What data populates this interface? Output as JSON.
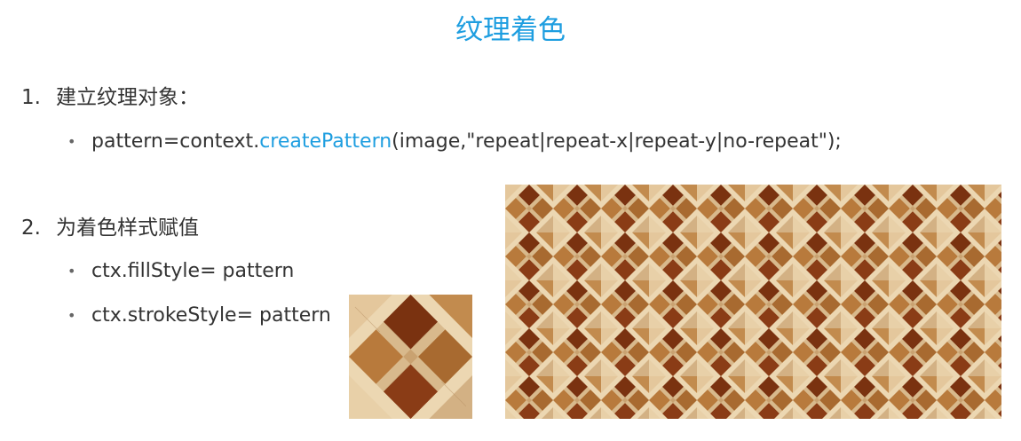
{
  "title": "纹理着色",
  "step1": {
    "number": "1.",
    "text": "建立纹理对象：",
    "code_prefix": "pattern=context.",
    "code_method": "createPattern",
    "code_suffix": "(image,\"repeat|repeat-x|repeat-y|no-repeat\");"
  },
  "step2": {
    "number": "2.",
    "text": "为着色样式赋值",
    "items": [
      {
        "bullet": "•",
        "text": "ctx.fillStyle= pattern"
      },
      {
        "bullet": "•",
        "text": "ctx.strokeStyle= pattern"
      }
    ]
  },
  "bullet_symbol": "•",
  "colors": {
    "title": "#1e9ee0",
    "code_highlight": "#1e9ee0",
    "text": "#333333",
    "wood_light": "#d8b98c",
    "wood_cream": "#ecd7b2",
    "wood_mid": "#b87a3c",
    "wood_dark": "#7a3210"
  }
}
